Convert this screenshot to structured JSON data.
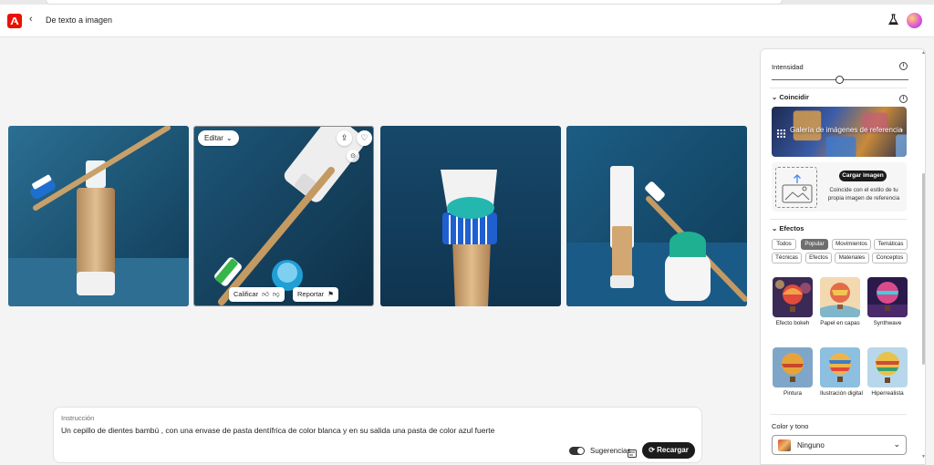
{
  "header": {
    "back_icon": "chevron-left-icon",
    "title": "De texto a imagen",
    "labs_icon": "flask-icon",
    "profile_icon": "avatar"
  },
  "gallery": {
    "images": [
      {
        "description_icon": "toothbrush-bamboo-tube"
      },
      {
        "description_icon": "toothbrush-tube-blue-paste"
      },
      {
        "description_icon": "tube-blue-paste-bristles"
      },
      {
        "description_icon": "tube-cup-toothbrush"
      }
    ],
    "selected_overlay": {
      "editar_label": "Editar",
      "calificar_label": "Calificar",
      "reportar_label": "Reportar"
    }
  },
  "prompt": {
    "label": "Instrucción",
    "text": "Un cepillo de dientes bambú , con una envase de pasta dentífrica de color blanca y en su salida una pasta de color azul fuerte",
    "suggestions_label": "Sugerencias",
    "reload_label": "Recargar"
  },
  "panel": {
    "intensidad_label": "Intensidad",
    "intensidad_value": 0.5,
    "coincidir_label": "Coincidir",
    "galeria_label": "Galería de imágenes de referencia",
    "cargar_label": "Cargar imagen",
    "cargar_desc": "Coincide con el estilo de tu propia imagen de referencia",
    "efectos_label": "Efectos",
    "chips_row1": [
      "Todos",
      "Popular",
      "Movimientos",
      "Temáticas"
    ],
    "chips_row2": [
      "Técnicas",
      "Efectos",
      "Materiales",
      "Conceptos"
    ],
    "active_chip": "Popular",
    "effects": [
      {
        "label": "Efecto bokeh"
      },
      {
        "label": "Papel en capas"
      },
      {
        "label": "Synthwave"
      },
      {
        "label": "Pintura"
      },
      {
        "label": "Ilustración digital"
      },
      {
        "label": "Hiperrealista"
      }
    ],
    "color_label": "Color y tono",
    "color_value": "Ninguno"
  },
  "colors": {
    "accent": "#eb1000",
    "dark_button": "#1b1b1b",
    "paste_blue": "#1f9fd6",
    "background_blue": "#1b4e6f"
  }
}
